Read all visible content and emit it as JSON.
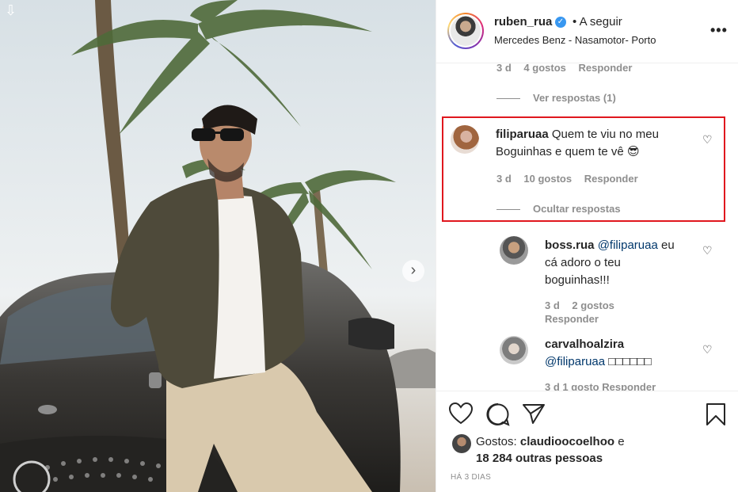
{
  "post": {
    "username": "ruben_rua",
    "verified_mark": "✓",
    "follow_status": "• A seguir",
    "location": "Mercedes Benz - Nasamotor- Porto",
    "more_glyph": "•••",
    "carousel_next": "›"
  },
  "comments": {
    "prev_meta": {
      "time": "3 d",
      "likes": "4 gostos",
      "reply": "Responder"
    },
    "prev_view_replies": "Ver respostas (1)",
    "main": {
      "username": "filiparuaa",
      "text_line1": "Quem te viu no meu",
      "text_line2": "Boguinhas e quem te vê 😎",
      "time": "3 d",
      "likes": "10 gostos",
      "reply": "Responder",
      "hide_replies": "Ocultar respostas"
    },
    "replies": [
      {
        "username": "boss.rua",
        "mention": "@filiparuaa",
        "text_a": "eu",
        "text_b": "cá adoro o teu",
        "text_c": "boguinhas!!!",
        "time": "3 d",
        "likes": "2 gostos",
        "reply": "Responder"
      },
      {
        "username": "carvalhoalzira",
        "mention": "@filiparuaa",
        "text": "□□□□□□",
        "cut_meta": "3 d   1 gosto   Responder"
      }
    ]
  },
  "actions": {
    "like_icon": "heart-icon",
    "comment_icon": "comment-icon",
    "share_icon": "share-icon",
    "save_icon": "bookmark-icon",
    "likes_prefix": "Gostos:",
    "likes_user": "claudioocoelhoo",
    "likes_conj": "e",
    "likes_others": "18 284 outras pessoas",
    "time_ago": "HÁ 3 DIAS"
  },
  "colors": {
    "highlight_border": "#e0171e",
    "mention": "#00376b",
    "muted": "#8e8e8e",
    "verified": "#3897f0"
  }
}
